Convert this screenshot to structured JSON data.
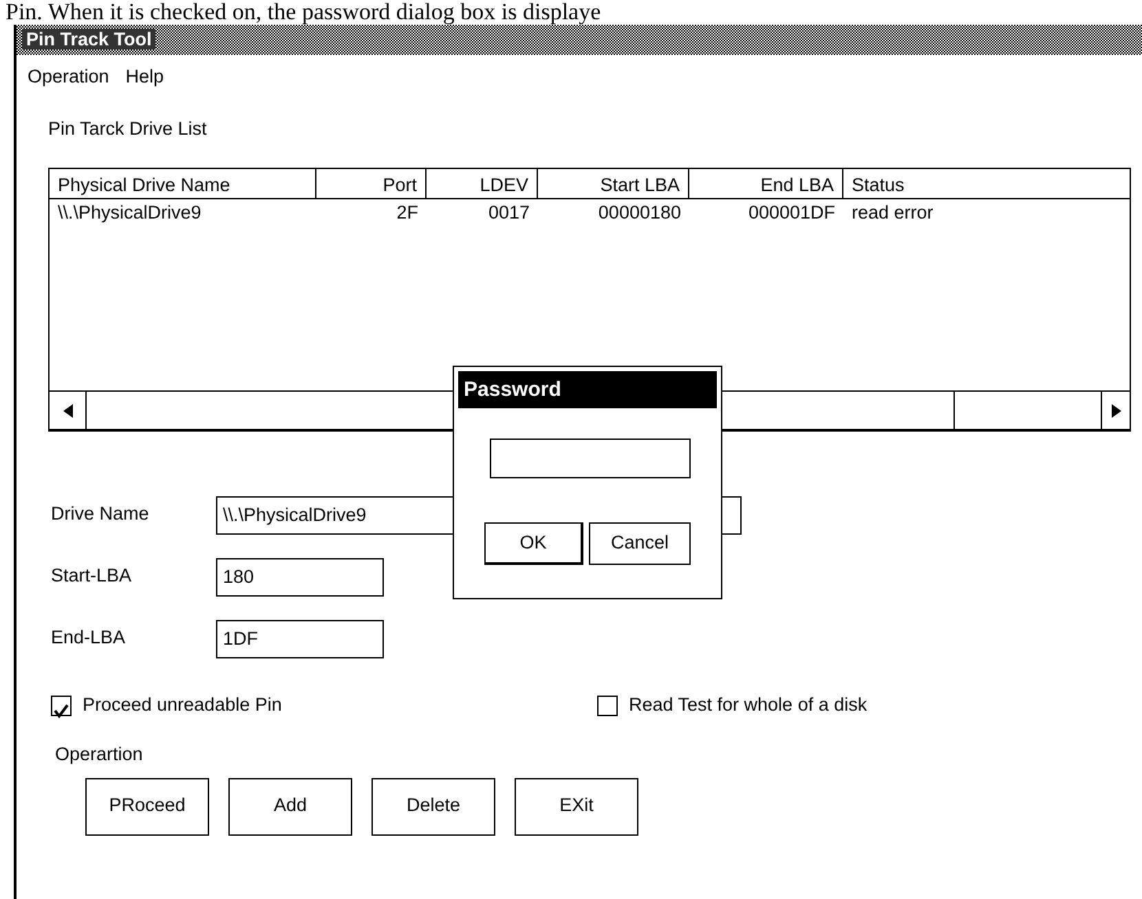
{
  "caption": "Pin.  When it is checked on, the password dialog box is displaye",
  "window": {
    "title": "Pin Track Tool"
  },
  "menu": [
    {
      "label": "Operation"
    },
    {
      "label": "Help"
    }
  ],
  "list_title": "Pin Tarck Drive List",
  "table": {
    "columns": [
      {
        "label": "Physical Drive Name"
      },
      {
        "label": "Port"
      },
      {
        "label": "LDEV"
      },
      {
        "label": "Start LBA"
      },
      {
        "label": "End LBA"
      },
      {
        "label": "Status"
      }
    ],
    "rows": [
      [
        "\\\\.\\PhysicalDrive9",
        "2F",
        "0017",
        "00000180",
        "000001DF",
        "read error"
      ]
    ]
  },
  "fields": [
    {
      "label": "Drive Name",
      "value": "\\\\.\\PhysicalDrive9"
    },
    {
      "label": "Start-LBA",
      "value": "180"
    },
    {
      "label": "End-LBA",
      "value": "1DF"
    }
  ],
  "checkboxes": [
    {
      "label": "Proceed unreadable Pin",
      "checked": true
    },
    {
      "label": "Read Test for whole of a disk",
      "checked": false
    }
  ],
  "operation_label": "Operartion",
  "buttons": [
    {
      "label": "PRoceed"
    },
    {
      "label": "Add"
    },
    {
      "label": "Delete"
    },
    {
      "label": "EXit"
    }
  ],
  "dialog": {
    "title": "Password",
    "buttons": [
      {
        "label": "OK",
        "default": true
      },
      {
        "label": "Cancel",
        "default": false
      }
    ]
  }
}
